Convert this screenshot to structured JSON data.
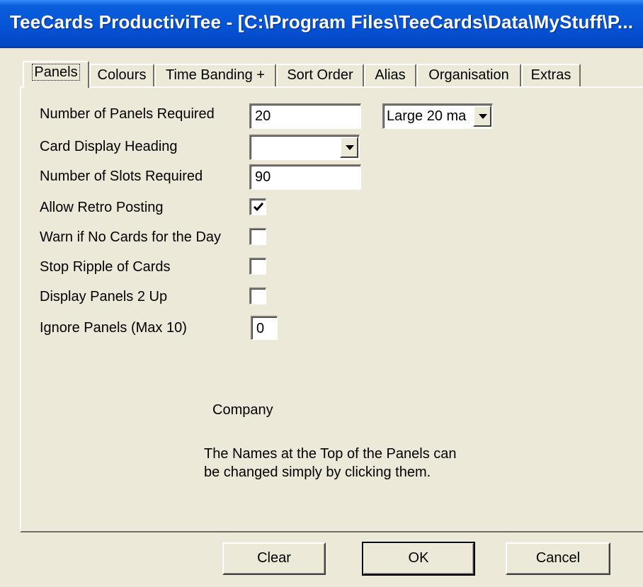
{
  "window": {
    "title": "TeeCards ProductiviTee - [C:\\Program Files\\TeeCards\\Data\\MyStuff\\P..."
  },
  "tabs": [
    {
      "label": "Panels",
      "active": true
    },
    {
      "label": "Colours",
      "active": false
    },
    {
      "label": "Time Banding +",
      "active": false
    },
    {
      "label": "Sort Order",
      "active": false
    },
    {
      "label": "Alias",
      "active": false
    },
    {
      "label": "Organisation",
      "active": false
    },
    {
      "label": "Extras",
      "active": false
    }
  ],
  "form": {
    "num_panels": {
      "label": "Number of Panels Required",
      "value": "20"
    },
    "panel_size": {
      "value": "Large 20 ma"
    },
    "card_heading": {
      "label": "Card Display Heading",
      "value": ""
    },
    "num_slots": {
      "label": "Number of Slots Required",
      "value": "90"
    },
    "allow_retro": {
      "label": "Allow Retro Posting",
      "checked": true
    },
    "warn_no_cards": {
      "label": "Warn if No Cards for the Day",
      "checked": false
    },
    "stop_ripple": {
      "label": "Stop Ripple of Cards",
      "checked": false
    },
    "display_2up": {
      "label": "Display Panels 2 Up",
      "checked": false
    },
    "ignore_panels": {
      "label": "Ignore Panels (Max 10)",
      "value": "0"
    }
  },
  "info": {
    "company": "Company",
    "hint_line1": "The Names at the Top of the Panels can",
    "hint_line2": "be changed simply by clicking them."
  },
  "buttons": {
    "clear": "Clear",
    "ok": "OK",
    "cancel": "Cancel"
  }
}
